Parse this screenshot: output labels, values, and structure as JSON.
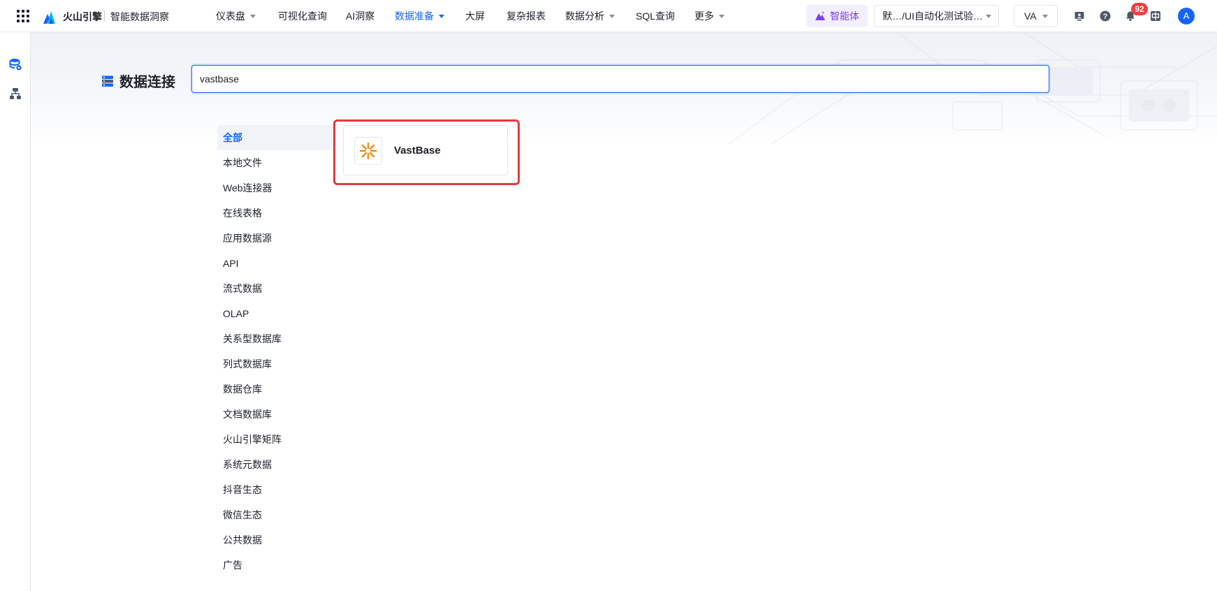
{
  "header": {
    "brand": "火山引擎",
    "product": "智能数据洞察",
    "nav": [
      {
        "label": "仪表盘",
        "dropdown": true,
        "active": false
      },
      {
        "label": "可视化查询",
        "dropdown": false,
        "active": false
      },
      {
        "label": "AI洞察",
        "dropdown": false,
        "active": false
      },
      {
        "label": "数据准备",
        "dropdown": true,
        "active": true
      },
      {
        "label": "大屏",
        "dropdown": false,
        "active": false
      },
      {
        "label": "复杂报表",
        "dropdown": false,
        "active": false
      },
      {
        "label": "数据分析",
        "dropdown": true,
        "active": false
      },
      {
        "label": "SQL查询",
        "dropdown": false,
        "active": false
      },
      {
        "label": "更多",
        "dropdown": true,
        "active": false
      }
    ],
    "agent_label": "智能体",
    "project_select": "默…/UI自动化测试验…",
    "user_select": "VA",
    "notification_count": "92",
    "avatar_letter": "A",
    "colors": {
      "accent": "#1664ff",
      "agent": "#7b3ff2",
      "badge": "#f53f3f"
    }
  },
  "sidebar": {
    "icons": [
      "database-connection-icon",
      "data-model-icon"
    ]
  },
  "main": {
    "title": "数据连接",
    "search_value": "vastbase",
    "categories": [
      "全部",
      "本地文件",
      "Web连接器",
      "在线表格",
      "应用数据源",
      "API",
      "流式数据",
      "OLAP",
      "关系型数据库",
      "列式数据库",
      "数据仓库",
      "文档数据库",
      "火山引擎矩阵",
      "系统元数据",
      "抖音生态",
      "微信生态",
      "公共数据",
      "广告"
    ],
    "active_category": "全部",
    "results": [
      {
        "name": "VastBase",
        "icon": "vastbase-logo-icon",
        "color": "#f08a12"
      }
    ],
    "highlight_color": "#e8393c"
  }
}
